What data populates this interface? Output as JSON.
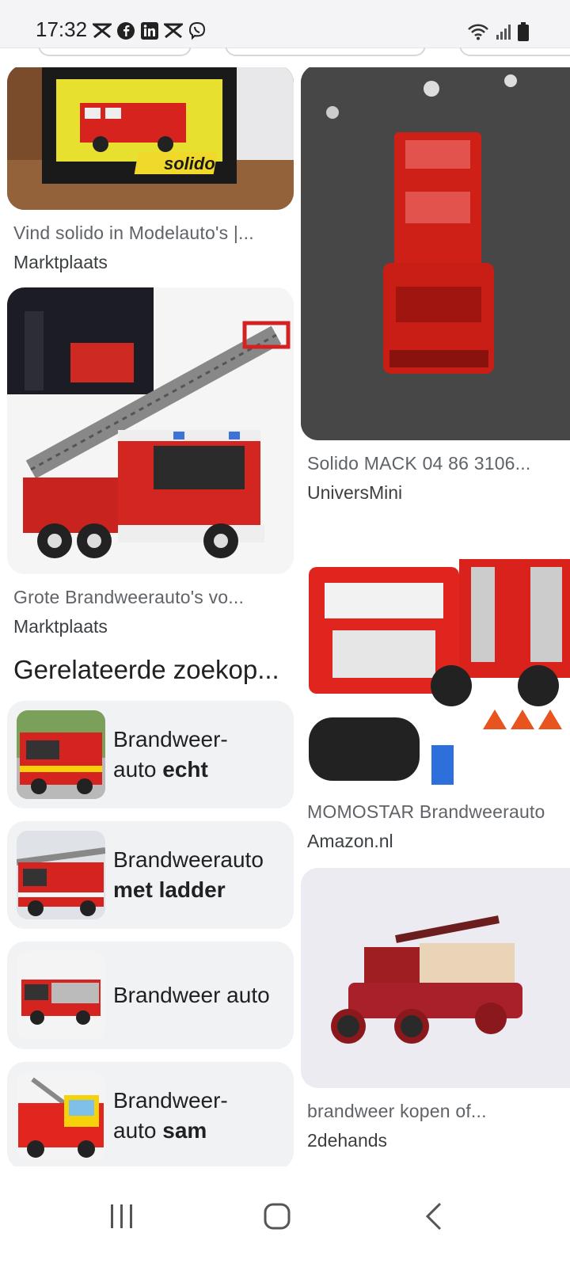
{
  "status_bar": {
    "time": "17:32",
    "left_icons": [
      "mail-x-icon",
      "facebook-icon",
      "linkedin-icon",
      "mail-x-icon",
      "viber-icon"
    ],
    "right_icons": [
      "wifi-icon",
      "signal-icon",
      "battery-icon"
    ]
  },
  "results": {
    "left": [
      {
        "title": "Vind solido in Modelauto's |...",
        "source": "Marktplaats",
        "image": "solido boxed fire truck model"
      },
      {
        "title": "Grote Brandweerauto's vo...",
        "source": "Marktplaats",
        "image": "lego style ladder fire truck"
      }
    ],
    "right": [
      {
        "title": "Solido MACK 04 86 3106...",
        "source": "UniversMini",
        "image": "red model fire truck top view"
      },
      {
        "title": "MOMOSTAR Brandweerauto",
        "source": "Amazon.nl",
        "image": "rc fire truck with controller"
      },
      {
        "title": "brandweer kopen of...",
        "source": "2dehands",
        "image": "vintage red fire engine model"
      }
    ]
  },
  "related": {
    "heading": "Gerelateerde zoekop...",
    "items": [
      {
        "line1": "Brandweer-",
        "plain": "auto ",
        "bold": "echt"
      },
      {
        "line1": "Brandweerauto",
        "plain": "",
        "bold": "met ladder"
      },
      {
        "line1": "Brandweer auto",
        "plain": "",
        "bold": ""
      },
      {
        "line1": "Brandweer-",
        "plain": "auto ",
        "bold": "sam"
      }
    ]
  },
  "nav": {
    "buttons": [
      "recent-apps-icon",
      "home-icon",
      "back-icon"
    ]
  },
  "colors": {
    "fire_red": "#d71f1f",
    "card_bg": "#f1f2f4",
    "text_secondary": "#5f6368"
  }
}
